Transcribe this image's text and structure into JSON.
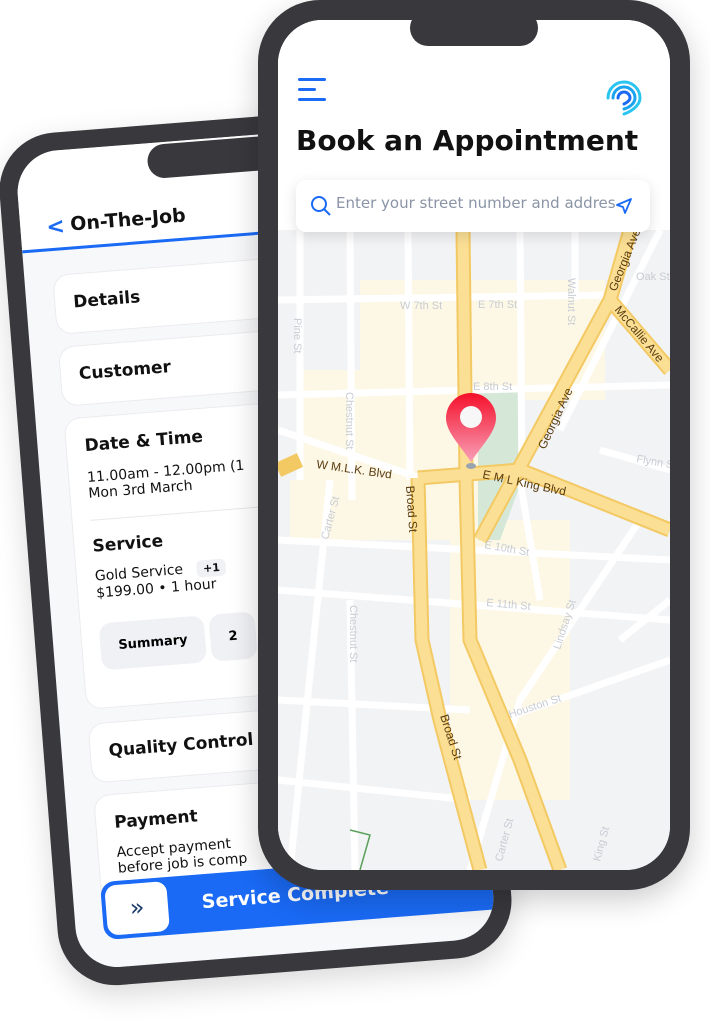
{
  "back_phone": {
    "header": {
      "title": "On-The-Job"
    },
    "sections": {
      "details": "Details",
      "customer": "Customer",
      "date_time": "Date & Time",
      "time_range": "11.00am - 12.00pm (1",
      "date": "Mon 3rd March",
      "service": "Service",
      "service_name": "Gold Service",
      "service_extra": "+1",
      "service_meta": "$199.00 • 1 hour",
      "summary_tab": "Summary",
      "second_tab": "2",
      "quality": "Quality Control",
      "payment": "Payment",
      "payment_text_1": "Accept payment",
      "payment_text_2": "before job is comp"
    },
    "cta": {
      "label": "Service Complete",
      "icon": "double-chevron-right"
    }
  },
  "front_phone": {
    "title": "Book an Appointment",
    "search": {
      "placeholder": "Enter your street number and address",
      "icon": "search",
      "action_icon": "navigation-arrow"
    },
    "map": {
      "pin_color": "#f0283c",
      "streets": {
        "w7": "W 7th St",
        "e7": "E 7th St",
        "e8": "E 8th St",
        "walnut": "Walnut St",
        "pine": "Pine St",
        "chestnut": "Chestnut St",
        "chestnut2": "Chestnut St",
        "georgia_top": "Georgia Ave",
        "georgia": "Georgia Ave",
        "mccallie": "McCallie Ave",
        "oak": "Oak St",
        "wmlk": "W M.L.K. Blvd",
        "emlk": "E M L King Blvd",
        "broad1": "Broad St",
        "broad2": "Broad St",
        "carter": "Carter St",
        "e10": "E 10th St",
        "e11": "E 11th St",
        "houston": "Houston St",
        "lindsay": "Lindsay St",
        "flynn": "Flynn St",
        "carter2": "Carter St",
        "king": "King St"
      }
    }
  },
  "colors": {
    "accent": "#1a6af5",
    "road": "#f8d98a",
    "frame": "#38383d"
  }
}
